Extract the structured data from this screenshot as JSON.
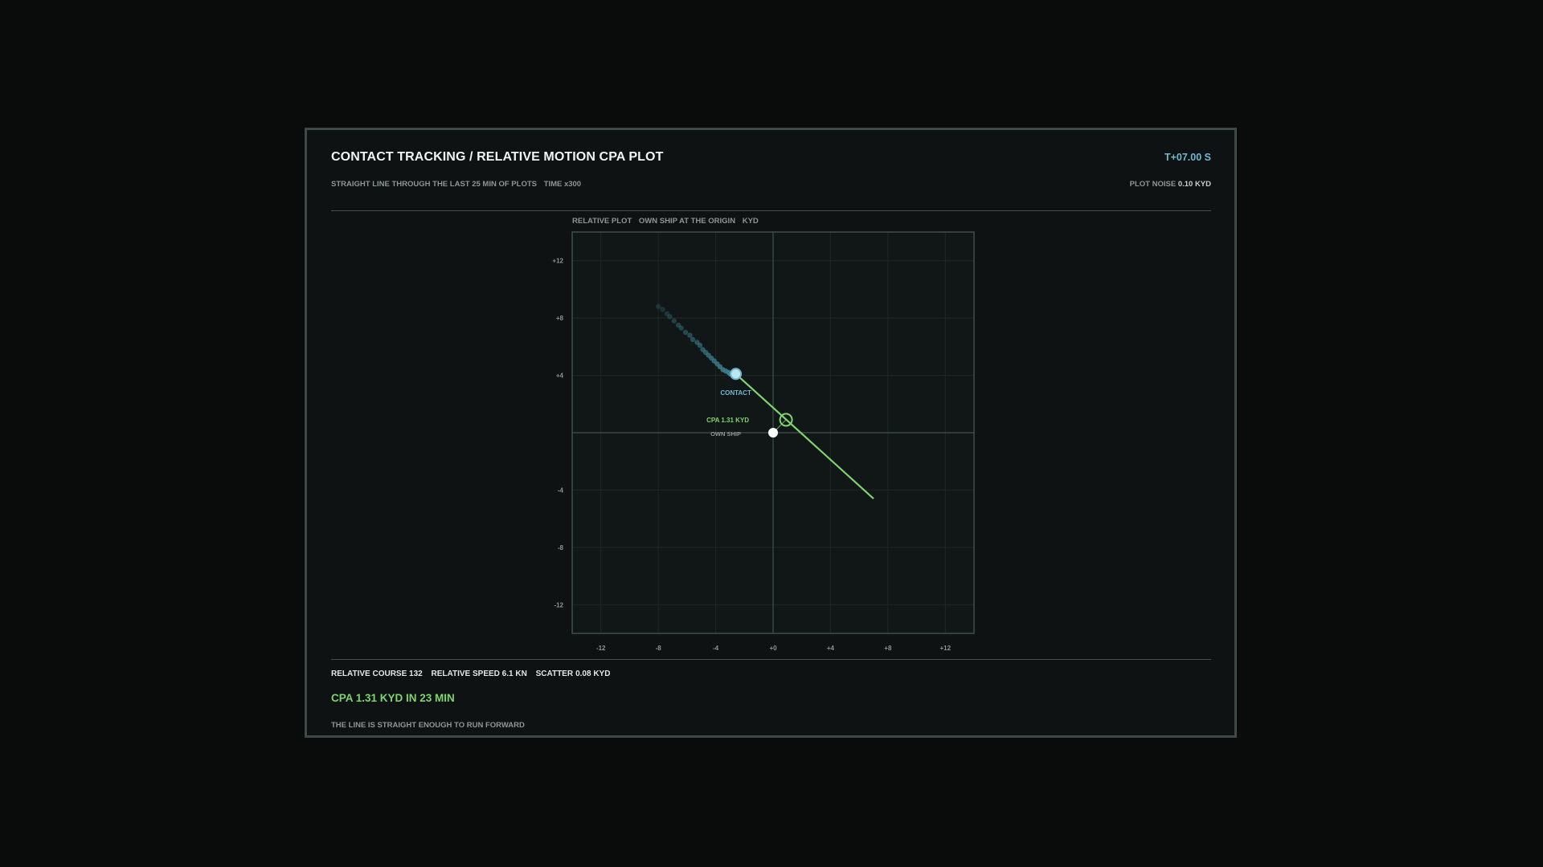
{
  "header": {
    "title": "CONTACT TRACKING / RELATIVE MOTION CPA PLOT",
    "subtitle_line": "STRAIGHT LINE THROUGH THE LAST 25 MIN OF PLOTS",
    "time_scale": "TIME x300",
    "clock": "T+07.00 S",
    "plot_noise_label": "PLOT NOISE",
    "plot_noise_value": "0.10 KYD"
  },
  "plot_caption": {
    "title": "RELATIVE PLOT",
    "origin_note": "OWN SHIP AT THE ORIGIN",
    "unit": "KYD"
  },
  "footer": {
    "relative_course": "RELATIVE COURSE 132",
    "relative_speed": "RELATIVE SPEED 6.1 KN",
    "scatter_label": "SCATTER",
    "scatter_value": "0.08 KYD",
    "cpa_summary": "CPA 1.31 KYD IN 23 MIN",
    "verdict": "THE LINE IS STRAIGHT ENOUGH TO RUN FORWARD"
  },
  "colors": {
    "accent_green": "#7ed46e",
    "contact_blue": "#6fb8d0",
    "track_dots": "#3e8090",
    "grid": "#1f2826",
    "axis": "#3f524e"
  },
  "chart_data": {
    "type": "scatter",
    "xlim": [
      -14,
      14
    ],
    "ylim": [
      -14,
      14
    ],
    "x_ticks": [
      -12,
      -8,
      -4,
      0,
      4,
      8,
      12
    ],
    "y_ticks": [
      12,
      8,
      4,
      -4,
      -8,
      -12
    ],
    "x_tick_labels": [
      "-12",
      "-8",
      "-4",
      "+0",
      "+4",
      "+8",
      "+12"
    ],
    "y_tick_labels": [
      "+12",
      "+8",
      "+4",
      "-4",
      "-8",
      "-12"
    ],
    "grid": true,
    "track_plots": [
      {
        "x": -8.0,
        "y": 8.8
      },
      {
        "x": -7.7,
        "y": 8.6
      },
      {
        "x": -7.4,
        "y": 8.3
      },
      {
        "x": -7.2,
        "y": 8.1
      },
      {
        "x": -6.9,
        "y": 7.8
      },
      {
        "x": -6.6,
        "y": 7.5
      },
      {
        "x": -6.4,
        "y": 7.3
      },
      {
        "x": -6.1,
        "y": 7.0
      },
      {
        "x": -5.8,
        "y": 6.8
      },
      {
        "x": -5.6,
        "y": 6.5
      },
      {
        "x": -5.3,
        "y": 6.3
      },
      {
        "x": -5.1,
        "y": 6.1
      },
      {
        "x": -4.9,
        "y": 5.8
      },
      {
        "x": -4.7,
        "y": 5.6
      },
      {
        "x": -4.5,
        "y": 5.4
      },
      {
        "x": -4.3,
        "y": 5.2
      },
      {
        "x": -4.1,
        "y": 5.0
      },
      {
        "x": -3.9,
        "y": 4.8
      },
      {
        "x": -3.7,
        "y": 4.6
      },
      {
        "x": -3.5,
        "y": 4.4
      },
      {
        "x": -3.3,
        "y": 4.3
      },
      {
        "x": -3.1,
        "y": 4.2
      },
      {
        "x": -3.0,
        "y": 4.1
      },
      {
        "x": -2.8,
        "y": 4.0
      },
      {
        "x": -2.7,
        "y": 4.0
      }
    ],
    "contact": {
      "x": -2.6,
      "y": 4.1,
      "label": "CONTACT"
    },
    "own_ship": {
      "x": 0,
      "y": 0,
      "label": "OWN SHIP"
    },
    "cpa_point": {
      "x": 0.9,
      "y": 0.9,
      "label": "CPA 1.31 KYD"
    },
    "projection_line": {
      "from": {
        "x": -2.6,
        "y": 4.1
      },
      "to": {
        "x": 7.0,
        "y": -4.6
      }
    }
  }
}
